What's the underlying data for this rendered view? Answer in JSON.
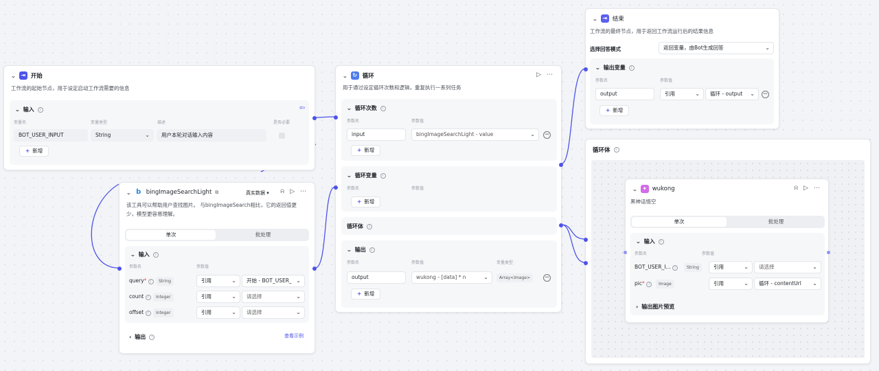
{
  "start": {
    "title": "开始",
    "desc": "工作流的起始节点，用于设定启动工作流需要的信息",
    "input_label": "输入",
    "col_name": "变量名",
    "col_type": "变量类型",
    "col_desc": "描述",
    "col_required": "是否必要",
    "var_name": "BOT_USER_INPUT",
    "var_type": "String",
    "var_desc": "用户本轮对话输入内容",
    "add": "新增"
  },
  "loop": {
    "title": "循环",
    "desc": "用于通过设定循环次数和逻辑，重复执行一系列任务",
    "count_label": "循环次数",
    "param_name": "参数名",
    "param_value": "参数值",
    "var_type": "变量类型",
    "count_name": "input",
    "count_value": "bingImageSearchLight - value",
    "add": "新增",
    "vars_label": "循环变量",
    "body_label": "循环体",
    "output_label": "输出",
    "out_name": "output",
    "out_value": "wukong - [data] * n",
    "out_type": "Array<Image>"
  },
  "bing": {
    "title": "bingImageSearchLight",
    "mode": "真实数据",
    "desc1": "该工具可以帮助用户查找图片。 与bingImageSearch相比，它的返回值更",
    "desc2": "少，模型更容易理解。",
    "tab_single": "单次",
    "tab_batch": "批处理",
    "input_label": "输入",
    "param_name": "参数名",
    "param_value": "参数值",
    "params": [
      {
        "name": "query",
        "type": "String",
        "ref": "引用",
        "value": "开始 - BOT_USER_"
      },
      {
        "name": "count",
        "type": "Integer",
        "ref": "引用",
        "value": "请选择"
      },
      {
        "name": "offset",
        "type": "Integer",
        "ref": "引用",
        "value": "请选择"
      }
    ],
    "output_label": "输出",
    "view_example": "查看示例"
  },
  "end": {
    "title": "结束",
    "desc": "工作流的最终节点，用于返回工作流运行后的结果信息",
    "mode_label": "选择回答模式",
    "mode_value": "返回变量，由Bot生成回答",
    "output_label": "输出变量",
    "param_name": "参数名",
    "param_value": "参数值",
    "out_name": "output",
    "out_ref": "引用",
    "out_value": "循环 - output",
    "add": "新增"
  },
  "loopbody": {
    "title": "循环体"
  },
  "wukong": {
    "title": "wukong",
    "desc": "黑神话悟空",
    "tab_single": "单次",
    "tab_batch": "批处理",
    "input_label": "输入",
    "param_name": "参数名",
    "param_value": "参数值",
    "params": [
      {
        "name": "BOT_USER_I...",
        "type": "String",
        "ref": "引用",
        "value": "请选择"
      },
      {
        "name": "pic",
        "type": "Image",
        "ref": "引用",
        "value": "循环 - contentUrl"
      }
    ],
    "preview_label": "输出图片预览"
  },
  "colors": {
    "accent": "#4d53e8",
    "start_icon": "#4d53e8",
    "loop_icon": "#4d7cf0",
    "end_icon": "#5b5ff0",
    "wukong_icon": "#d16ce6",
    "bing_icon": "#1e88e5"
  },
  "icons": {
    "start": "enter-icon",
    "loop": "loop-icon",
    "end": "exit-icon",
    "wukong": "puzzle-icon",
    "bing": "bing-logo-icon"
  }
}
